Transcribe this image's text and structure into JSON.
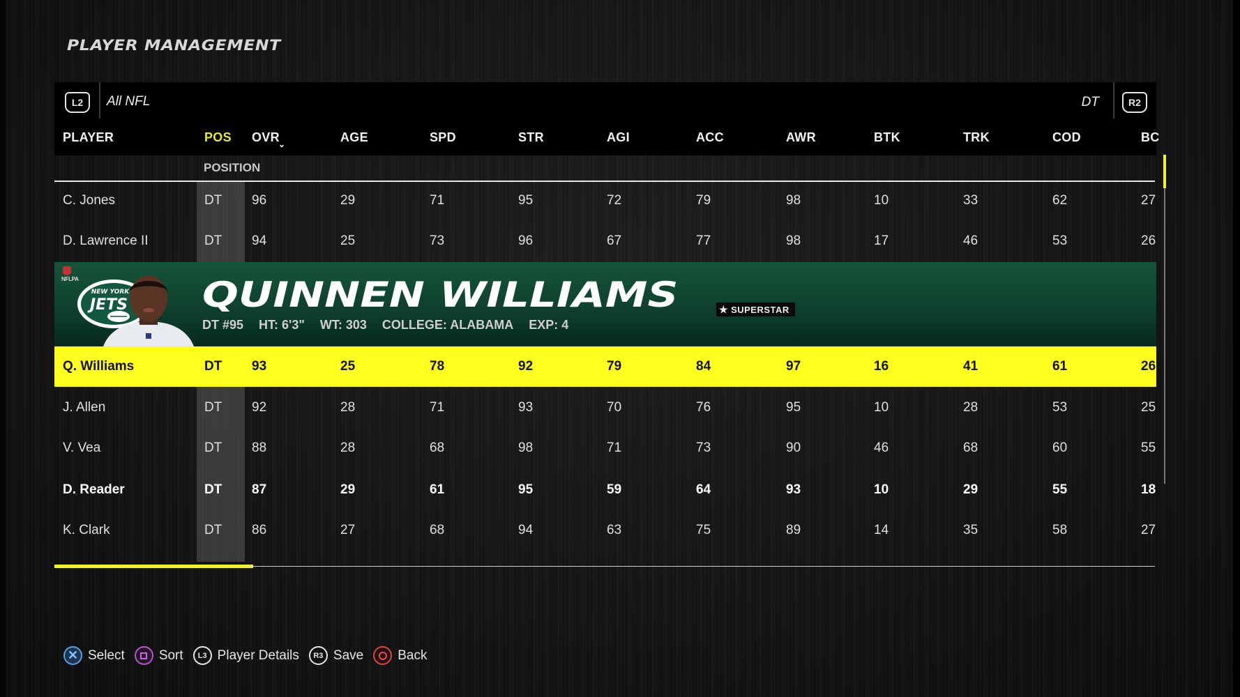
{
  "page": {
    "title": "PLAYER MANAGEMENT"
  },
  "header": {
    "left_trigger": "L2",
    "right_trigger": "R2",
    "filter": "All NFL",
    "position_filter": "DT",
    "sub_header": "POSITION"
  },
  "columns": [
    {
      "key": "player",
      "label": "PLAYER"
    },
    {
      "key": "pos",
      "label": "POS",
      "active": true
    },
    {
      "key": "ovr",
      "label": "OVR",
      "sorted": "descending"
    },
    {
      "key": "age",
      "label": "AGE"
    },
    {
      "key": "spd",
      "label": "SPD"
    },
    {
      "key": "str",
      "label": "STR"
    },
    {
      "key": "agi",
      "label": "AGI"
    },
    {
      "key": "acc",
      "label": "ACC"
    },
    {
      "key": "awr",
      "label": "AWR"
    },
    {
      "key": "btk",
      "label": "BTK"
    },
    {
      "key": "trk",
      "label": "TRK"
    },
    {
      "key": "cod",
      "label": "COD"
    },
    {
      "key": "bc",
      "label": "BC"
    }
  ],
  "rows": [
    {
      "cells": [
        "C. Jones",
        "DT",
        "96",
        "29",
        "71",
        "95",
        "72",
        "79",
        "98",
        "10",
        "33",
        "62",
        "27"
      ]
    },
    {
      "cells": [
        "D. Lawrence II",
        "DT",
        "94",
        "25",
        "73",
        "96",
        "67",
        "77",
        "98",
        "17",
        "46",
        "53",
        "26"
      ]
    },
    {
      "cells": [
        "Q. Williams",
        "DT",
        "93",
        "25",
        "78",
        "92",
        "79",
        "84",
        "97",
        "16",
        "41",
        "61",
        "26"
      ],
      "selected": true
    },
    {
      "cells": [
        "J. Allen",
        "DT",
        "92",
        "28",
        "71",
        "93",
        "70",
        "76",
        "95",
        "10",
        "28",
        "53",
        "25"
      ]
    },
    {
      "cells": [
        "V. Vea",
        "DT",
        "88",
        "28",
        "68",
        "98",
        "71",
        "73",
        "90",
        "46",
        "68",
        "60",
        "55"
      ]
    },
    {
      "cells": [
        "D. Reader",
        "DT",
        "87",
        "29",
        "61",
        "95",
        "59",
        "64",
        "93",
        "10",
        "29",
        "55",
        "18"
      ],
      "bold": true
    },
    {
      "cells": [
        "K. Clark",
        "DT",
        "86",
        "27",
        "68",
        "94",
        "63",
        "75",
        "89",
        "14",
        "35",
        "58",
        "27"
      ]
    }
  ],
  "banner": {
    "player_name": "QUINNEN WILLIAMS",
    "team": "New York Jets",
    "team_logo_text_top": "NEW YORK",
    "team_logo_text_main": "JETS",
    "nflpa_label": "NFLPA",
    "position_number": "DT #95",
    "height": "HT: 6'3\"",
    "weight": "WT: 303",
    "college": "COLLEGE: ALABAMA",
    "experience": "EXP: 4",
    "badge": "SUPERSTAR"
  },
  "footer": {
    "hints": [
      {
        "button": "cross",
        "label": "Select"
      },
      {
        "button": "square",
        "label": "Sort"
      },
      {
        "button": "L3",
        "label": "Player Details"
      },
      {
        "button": "R3",
        "label": "Save"
      },
      {
        "button": "circle",
        "label": "Back"
      }
    ]
  },
  "colors": {
    "accent_yellow": "#ffff1f",
    "team_green": "#145438",
    "background": "#141414"
  }
}
